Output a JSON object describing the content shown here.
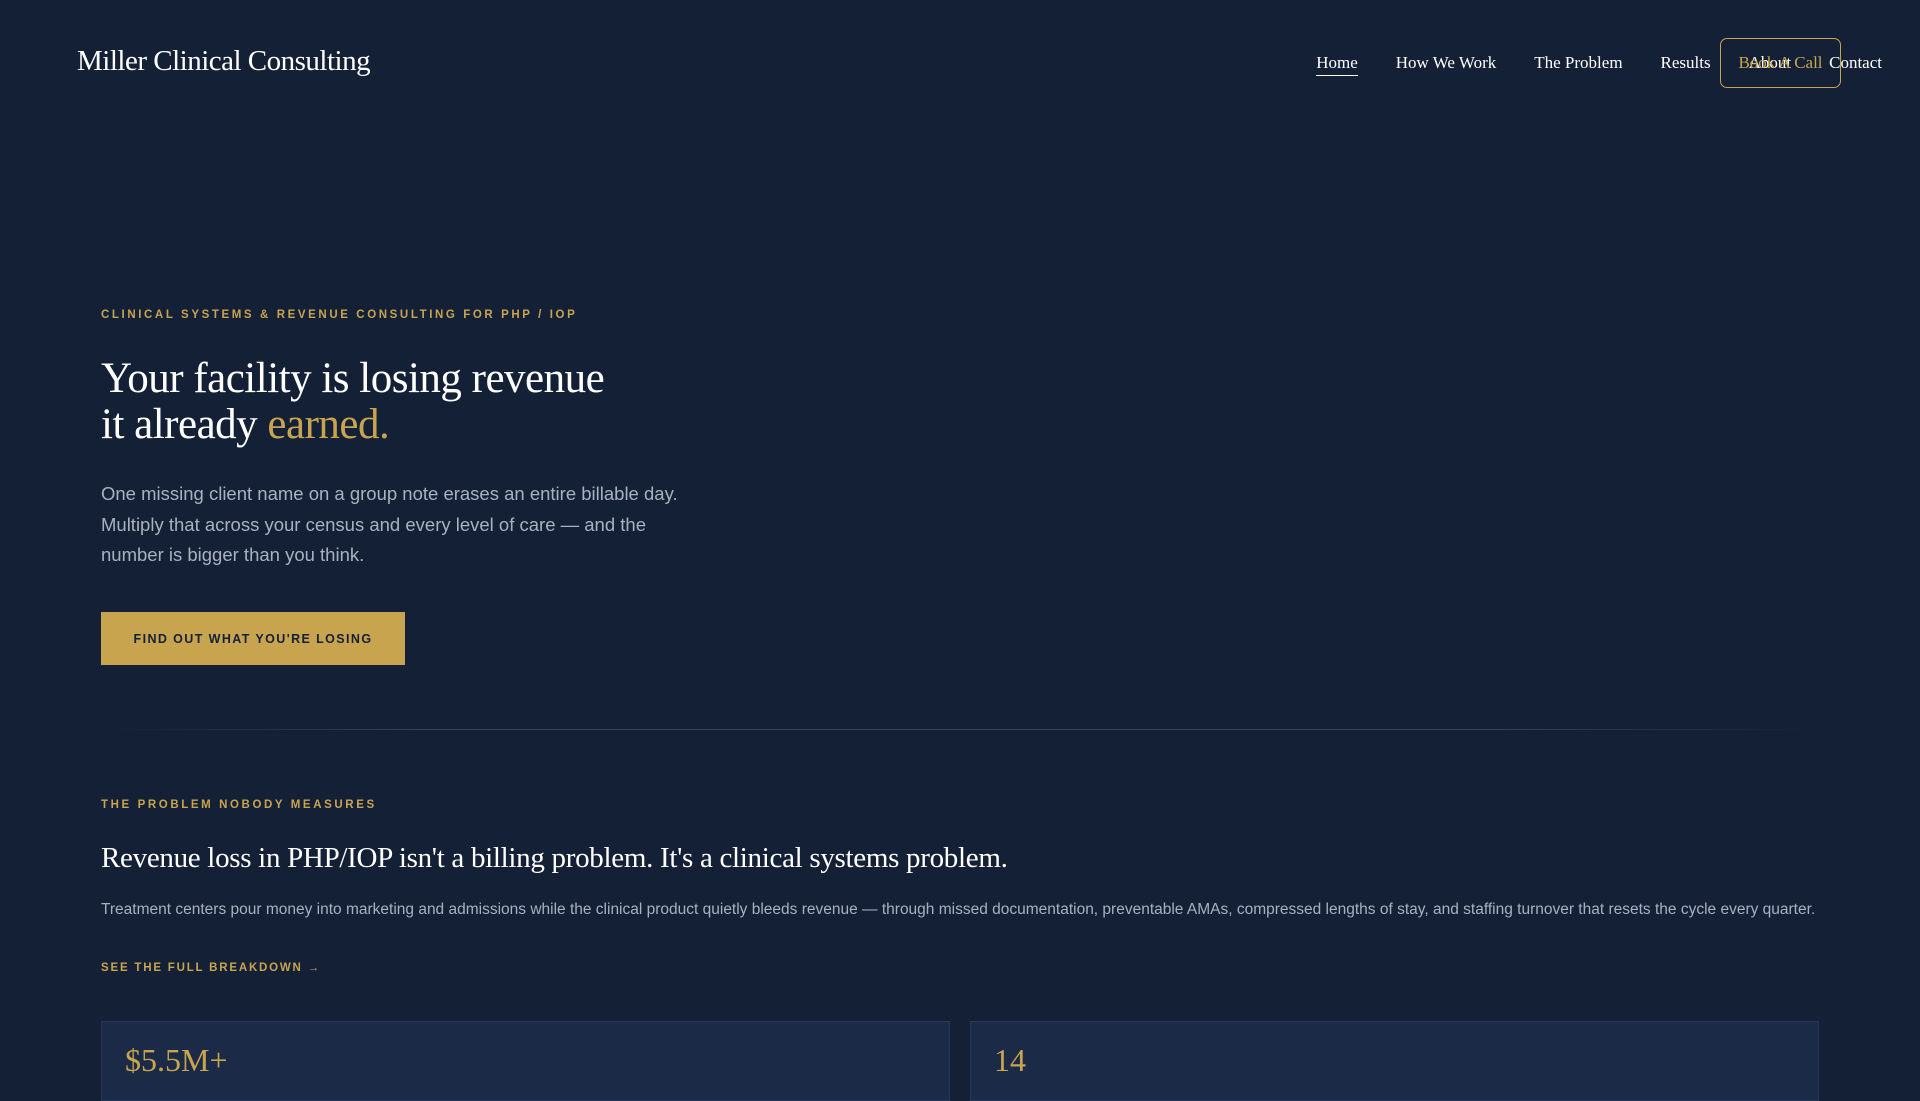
{
  "header": {
    "logo": "Miller Clinical Consulting",
    "nav": [
      "Home",
      "How We Work",
      "The Problem",
      "Results",
      "About",
      "Contact"
    ],
    "cta": "Book A Call"
  },
  "hero": {
    "eyebrow": "CLINICAL SYSTEMS & REVENUE CONSULTING FOR PHP / IOP",
    "title_line1": "Your facility is losing revenue",
    "title_line2": "it already ",
    "title_accent": "earned.",
    "lead": "One missing client name on a group note erases an entire billable day. Multiply that across your census and every level of care — and the number is bigger than you think.",
    "button": "FIND OUT WHAT YOU'RE LOSING"
  },
  "problem": {
    "eyebrow": "THE PROBLEM NOBODY MEASURES",
    "title": "Revenue loss in PHP/IOP isn't a billing problem. It's a clinical systems problem.",
    "text": "Treatment centers pour money into marketing and admissions while the clinical product quietly bleeds revenue — through missed documentation, preventable AMAs, compressed lengths of stay, and staffing turnover that resets the cycle every quarter.",
    "link": "SEE THE FULL BREAKDOWN →",
    "stats": [
      "$5.5M+",
      "14"
    ]
  },
  "colors": {
    "background": "#132036",
    "accent": "#c9a44f",
    "card": "#1b2b47"
  }
}
